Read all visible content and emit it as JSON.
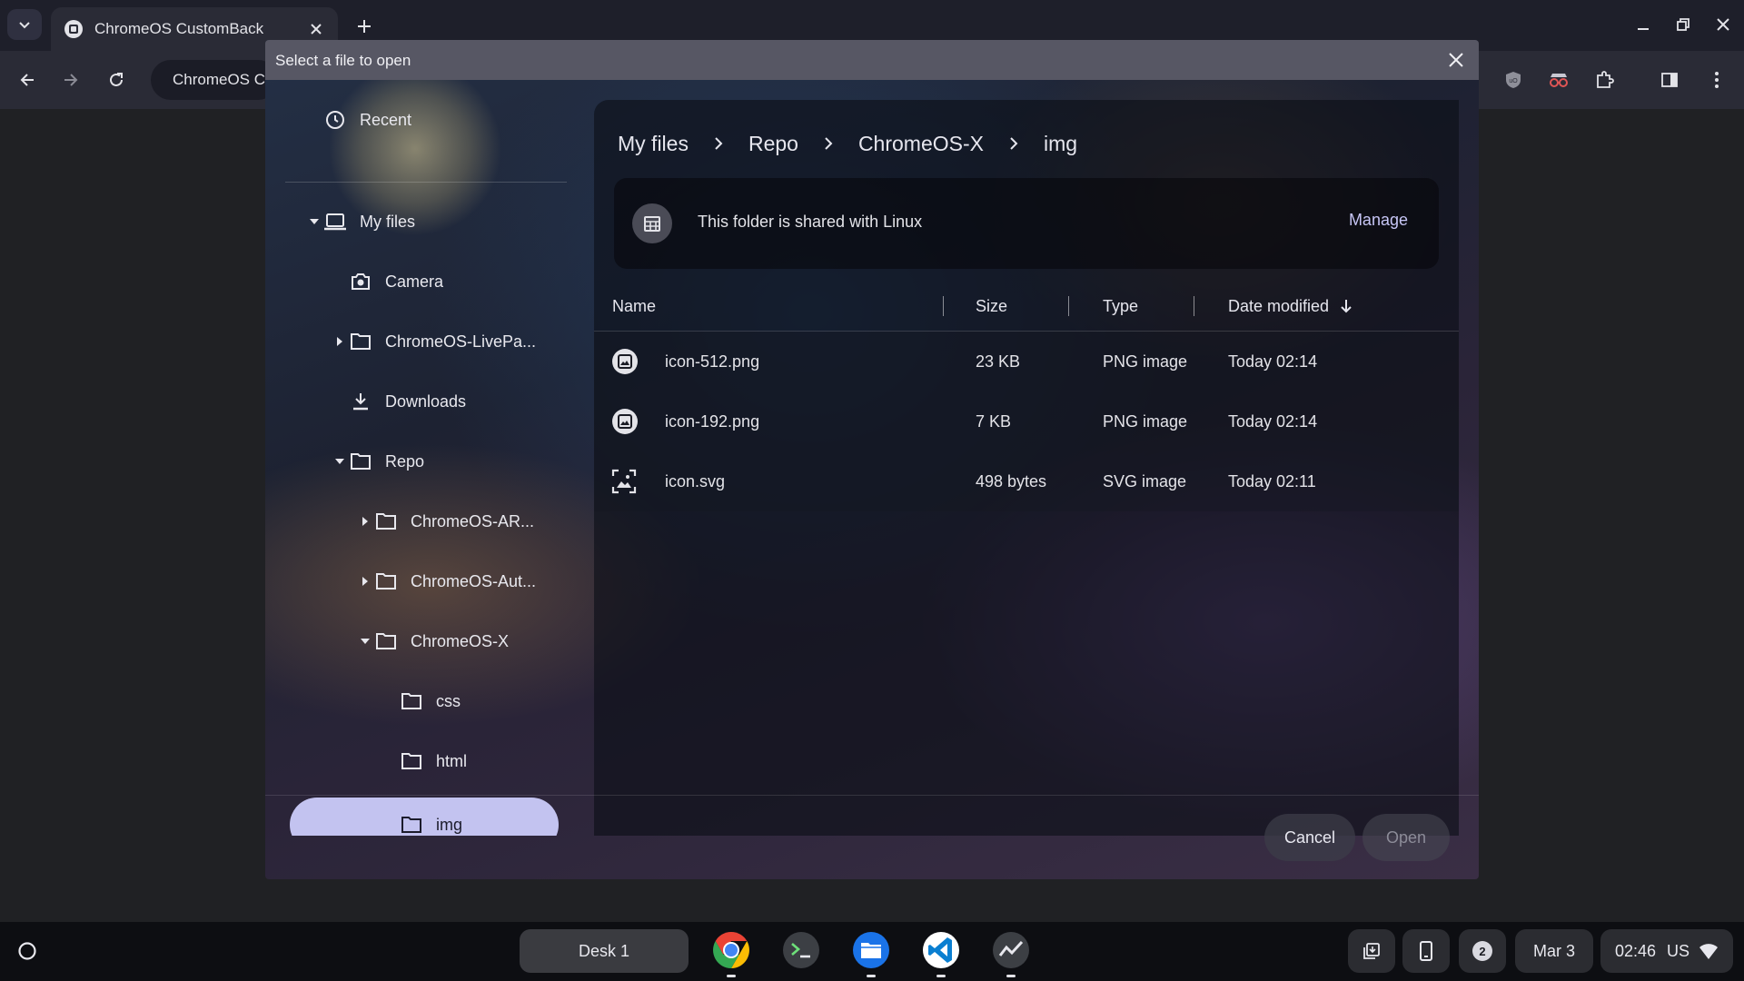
{
  "browser": {
    "tab_title": "ChromeOS CustomBack",
    "omnibox_text": "ChromeOS CustomBack"
  },
  "dialog": {
    "title": "Select a file to open",
    "sidebar": {
      "recent": "Recent",
      "my_files": "My files",
      "camera": "Camera",
      "livepaper": "ChromeOS-LivePa...",
      "downloads": "Downloads",
      "repo": "Repo",
      "ar": "ChromeOS-AR...",
      "aut": "ChromeOS-Aut...",
      "chromeos_x": "ChromeOS-X",
      "css": "css",
      "html": "html",
      "img": "img"
    },
    "breadcrumb": [
      "My files",
      "Repo",
      "ChromeOS-X",
      "img"
    ],
    "banner": {
      "text": "This folder is shared with Linux",
      "action": "Manage"
    },
    "columns": {
      "name": "Name",
      "size": "Size",
      "type": "Type",
      "date": "Date modified"
    },
    "files": [
      {
        "name": "icon-512.png",
        "size": "23 KB",
        "type": "PNG image",
        "date": "Today 02:14",
        "icon": "png-file-icon"
      },
      {
        "name": "icon-192.png",
        "size": "7 KB",
        "type": "PNG image",
        "date": "Today 02:14",
        "icon": "png-file-icon"
      },
      {
        "name": "icon.svg",
        "size": "498 bytes",
        "type": "SVG image",
        "date": "Today 02:11",
        "icon": "image-file-icon"
      }
    ],
    "buttons": {
      "cancel": "Cancel",
      "open": "Open"
    }
  },
  "shelf": {
    "desk": "Desk 1",
    "notification_count": "2",
    "date": "Mar 3",
    "time": "02:46",
    "locale": "US"
  },
  "colors": {
    "accent": "#c3c3f0",
    "link": "#c7c6f6"
  }
}
